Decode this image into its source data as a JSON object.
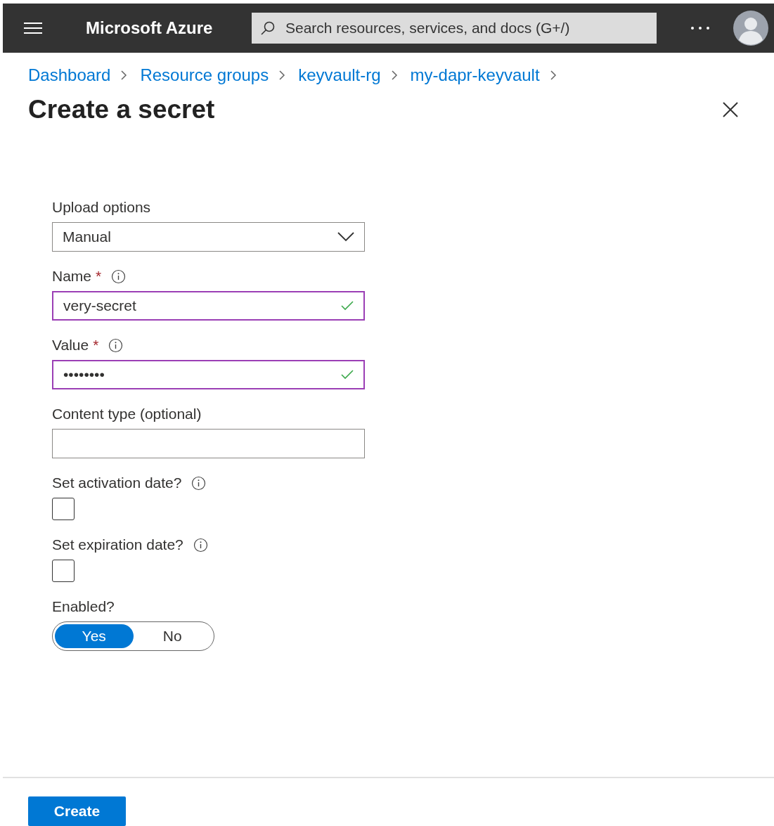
{
  "header": {
    "title": "Microsoft Azure",
    "search": {
      "placeholder": "Search resources, services, and docs (G+/)"
    }
  },
  "breadcrumb": [
    "Dashboard",
    "Resource groups",
    "keyvault-rg",
    "my-dapr-keyvault"
  ],
  "title": "Create a secret",
  "fields": [
    {
      "kind": "select",
      "label": "Upload options",
      "value": "Manual"
    },
    {
      "kind": "text",
      "label": "Name",
      "required_mark": "*",
      "info": true,
      "value": "very-secret",
      "valid": true
    },
    {
      "kind": "text",
      "label": "Value",
      "required_mark": "*",
      "info": true,
      "value": "••••••••",
      "valid": true
    },
    {
      "kind": "text",
      "label": "Content type (optional)",
      "valid": false
    },
    {
      "kind": "checkbox",
      "label": "Set activation date?",
      "info": true,
      "checked": false
    },
    {
      "kind": "checkbox",
      "label": "Set expiration date?",
      "info": true,
      "checked": false
    },
    {
      "kind": "toggle",
      "label": "Enabled?",
      "options": [
        {
          "label": "Yes",
          "selected": true
        },
        {
          "label": "No",
          "selected": false
        }
      ]
    }
  ],
  "primary_button": "Create"
}
